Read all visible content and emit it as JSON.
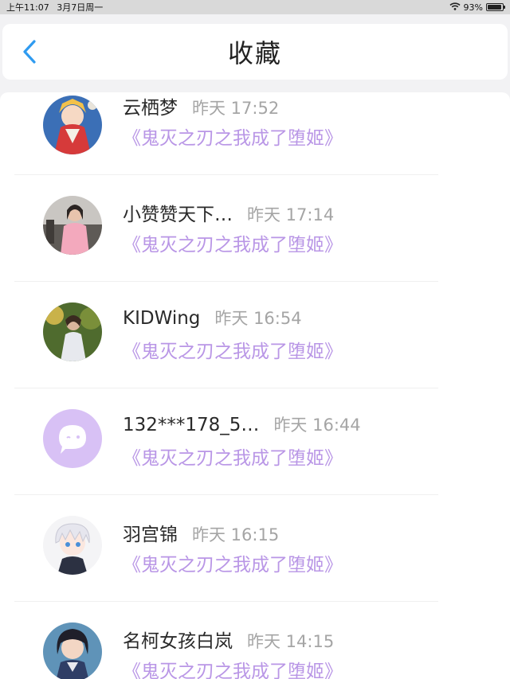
{
  "status": {
    "time": "上午11:07",
    "date": "3月7日周一",
    "battery": "93%",
    "battery_level": 0.93
  },
  "nav": {
    "title": "收藏",
    "back_icon": "chevron-left-icon",
    "accent": "#2f9bf0"
  },
  "favorites": [
    {
      "name": "云栖梦",
      "time": "昨天 17:52",
      "title": "《鬼灭之刃之我成了堕姬》",
      "avatar": "anime-girl-red-avatar"
    },
    {
      "name": "小赞赞天下…",
      "time": "昨天 17:14",
      "title": "《鬼灭之刃之我成了堕姬》",
      "avatar": "photo-girl-pink-avatar"
    },
    {
      "name": "KIDWing",
      "time": "昨天 16:54",
      "title": "《鬼灭之刃之我成了堕姬》",
      "avatar": "photo-outdoor-avatar"
    },
    {
      "name": "132***178_5…",
      "time": "昨天 16:44",
      "title": "《鬼灭之刃之我成了堕姬》",
      "avatar": "default-chat-avatar"
    },
    {
      "name": "羽宫锦",
      "time": "昨天 16:15",
      "title": "《鬼灭之刃之我成了堕姬》",
      "avatar": "anime-white-hair-avatar"
    },
    {
      "name": "名柯女孩白岚",
      "time": "昨天 14:15",
      "title": "《鬼灭之刃之我成了堕姬》",
      "avatar": "anime-dark-hair-avatar"
    }
  ],
  "colors": {
    "title_purple": "#b996e6",
    "time_gray": "#a5a5a5",
    "default_avatar": "#d8c1f5"
  }
}
